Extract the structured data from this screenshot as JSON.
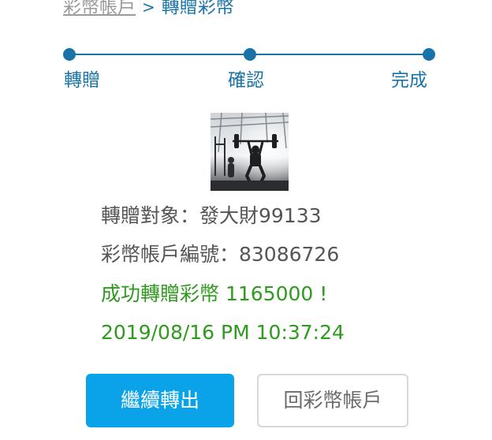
{
  "breadcrumb": {
    "parent": "彩幣帳戶",
    "separator": ">",
    "current": "轉贈彩幣"
  },
  "stepper": {
    "steps": [
      {
        "label": "轉贈"
      },
      {
        "label": "確認"
      },
      {
        "label": "完成"
      }
    ],
    "color": "#1a73a8"
  },
  "recipient": {
    "photo_icon": "avatar-photo-gym"
  },
  "info": {
    "target_line": "轉贈對象：發大財99133",
    "account_line": "彩幣帳戶編號：83086726",
    "success_line": "成功轉贈彩幣 1165000 !",
    "timestamp": "2019/08/16 PM 10:37:24"
  },
  "buttons": {
    "continue_label": "繼續轉出",
    "back_label": "回彩幣帳戶"
  },
  "colors": {
    "accent": "#1a73a8",
    "success": "#2e9a1e",
    "primary_button": "#0aa3ea"
  }
}
